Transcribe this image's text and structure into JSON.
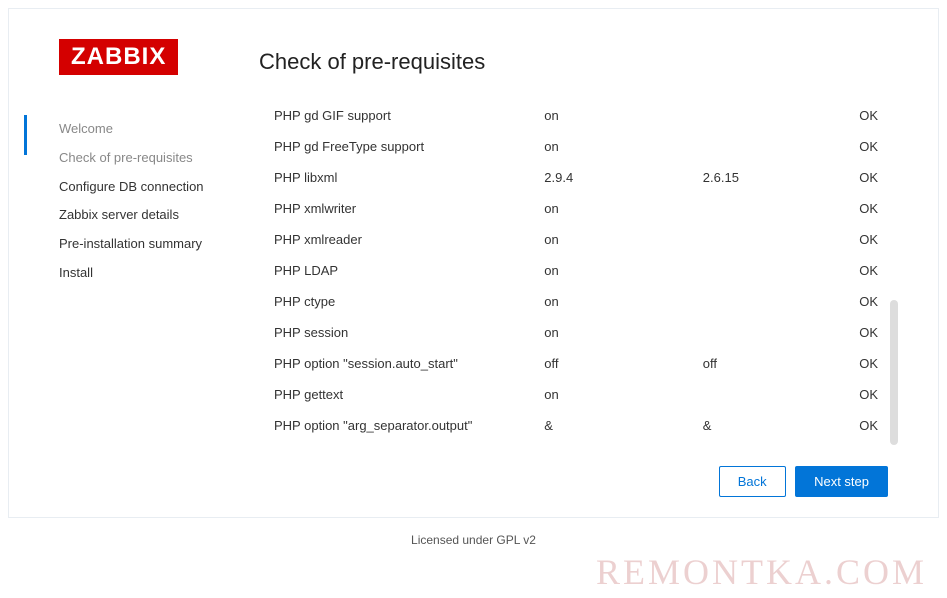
{
  "logo": "ZABBIX",
  "page_title": "Check of pre-requisites",
  "nav": {
    "items": [
      {
        "label": "Welcome",
        "state": "completed"
      },
      {
        "label": "Check of pre-requisites",
        "state": "active"
      },
      {
        "label": "Configure DB connection",
        "state": "pending"
      },
      {
        "label": "Zabbix server details",
        "state": "pending"
      },
      {
        "label": "Pre-installation summary",
        "state": "pending"
      },
      {
        "label": "Install",
        "state": "pending"
      }
    ]
  },
  "checks": [
    {
      "name": "PHP gd GIF support",
      "current": "on",
      "required": "",
      "status": "OK"
    },
    {
      "name": "PHP gd FreeType support",
      "current": "on",
      "required": "",
      "status": "OK"
    },
    {
      "name": "PHP libxml",
      "current": "2.9.4",
      "required": "2.6.15",
      "status": "OK"
    },
    {
      "name": "PHP xmlwriter",
      "current": "on",
      "required": "",
      "status": "OK"
    },
    {
      "name": "PHP xmlreader",
      "current": "on",
      "required": "",
      "status": "OK"
    },
    {
      "name": "PHP LDAP",
      "current": "on",
      "required": "",
      "status": "OK"
    },
    {
      "name": "PHP ctype",
      "current": "on",
      "required": "",
      "status": "OK"
    },
    {
      "name": "PHP session",
      "current": "on",
      "required": "",
      "status": "OK"
    },
    {
      "name": "PHP option \"session.auto_start\"",
      "current": "off",
      "required": "off",
      "status": "OK"
    },
    {
      "name": "PHP gettext",
      "current": "on",
      "required": "",
      "status": "OK"
    },
    {
      "name": "PHP option \"arg_separator.output\"",
      "current": "&",
      "required": "&",
      "status": "OK"
    }
  ],
  "buttons": {
    "back": "Back",
    "next": "Next step"
  },
  "footer": "Licensed under GPL v2",
  "watermark": "REMONTKA.COM",
  "colors": {
    "brand_red": "#d40000",
    "link_blue": "#0275d8",
    "ok_green": "#4caf50"
  }
}
